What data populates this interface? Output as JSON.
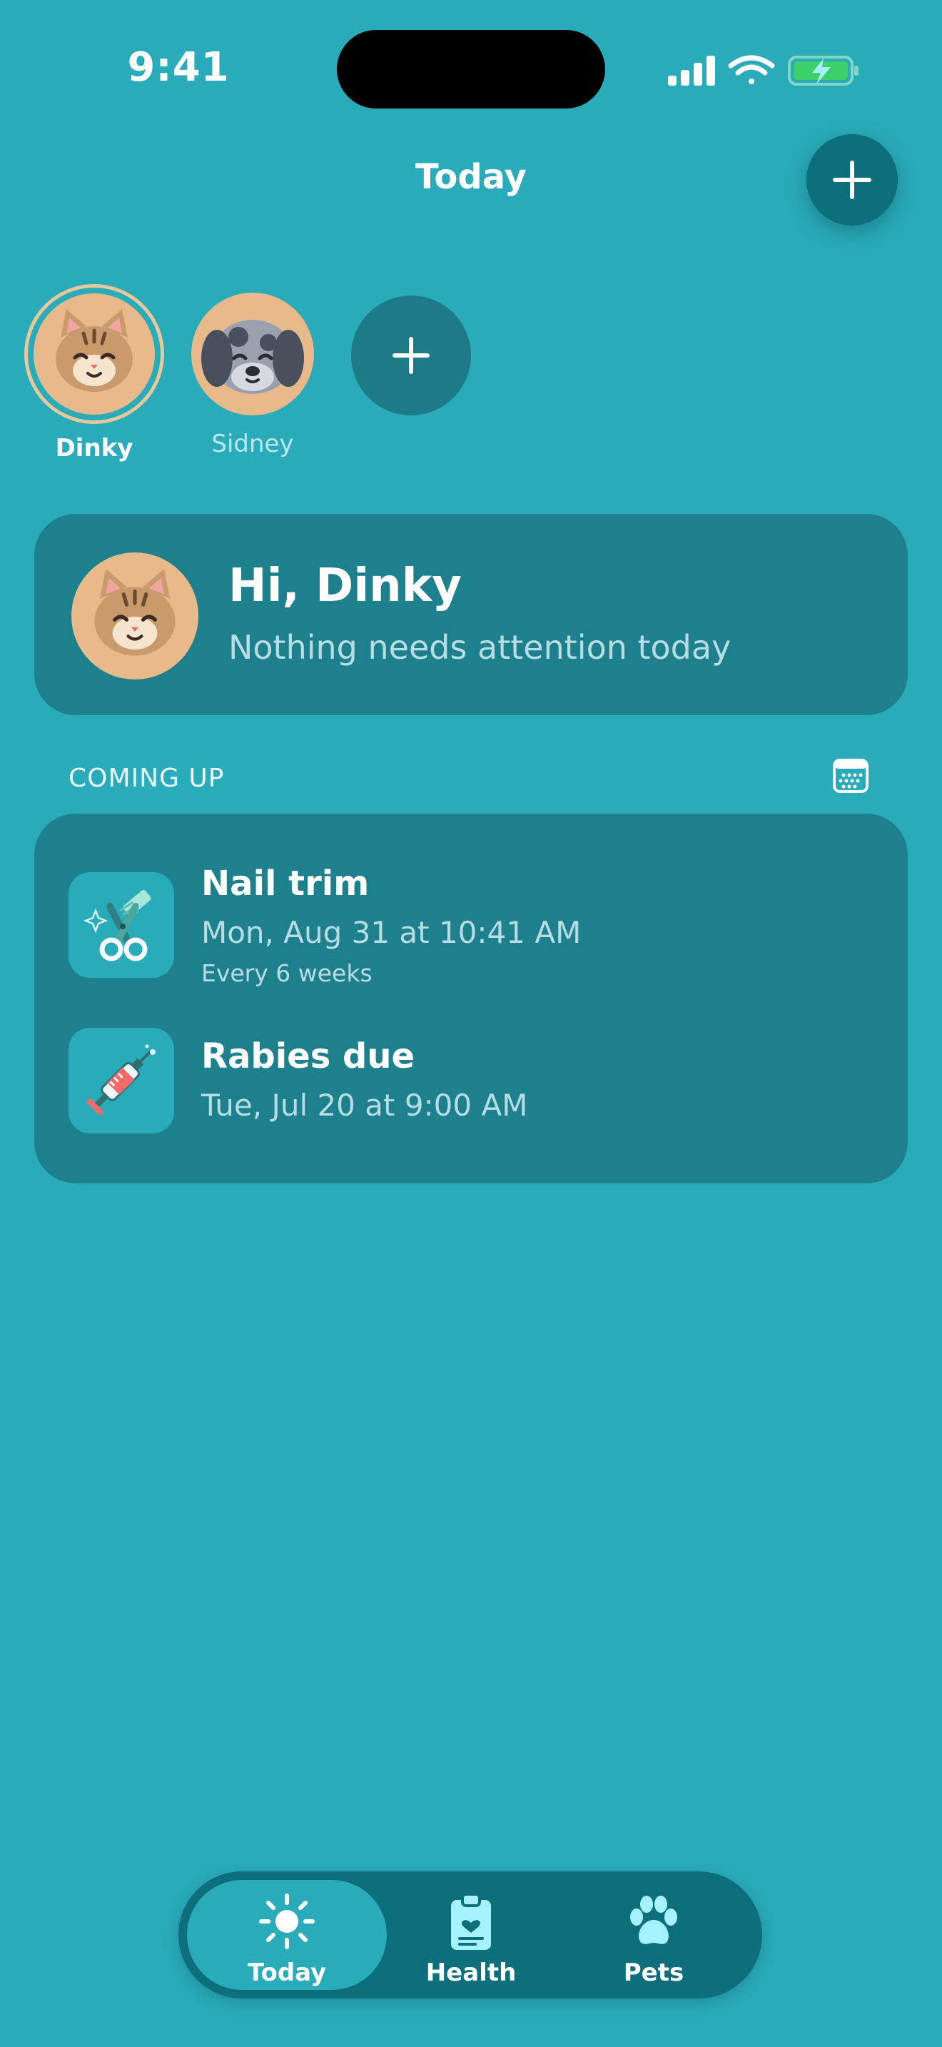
{
  "status_bar": {
    "time": "9:41"
  },
  "header": {
    "title": "Today"
  },
  "pets": [
    {
      "name": "Dinky",
      "selected": true
    },
    {
      "name": "Sidney",
      "selected": false
    }
  ],
  "greeting": {
    "title": "Hi, Dinky",
    "subtitle": "Nothing needs attention today"
  },
  "coming_up": {
    "label": "COMING UP",
    "events": [
      {
        "title": "Nail trim",
        "when": "Mon, Aug 31 at 10:41 AM",
        "repeat": "Every 6 weeks",
        "icon": "grooming-scissors-icon"
      },
      {
        "title": "Rabies due",
        "when": "Tue, Jul 20 at 9:00 AM",
        "icon": "syringe-icon"
      }
    ]
  },
  "tabs": [
    {
      "label": "Today",
      "icon": "sun-icon",
      "active": true
    },
    {
      "label": "Health",
      "icon": "clipboard-icon",
      "active": false
    },
    {
      "label": "Pets",
      "icon": "paw-icon",
      "active": false
    }
  ],
  "colors": {
    "background": "#2aabb9",
    "card": "#1f808d",
    "accent_dark": "#0d6e7c",
    "ring": "#e6c89a"
  }
}
